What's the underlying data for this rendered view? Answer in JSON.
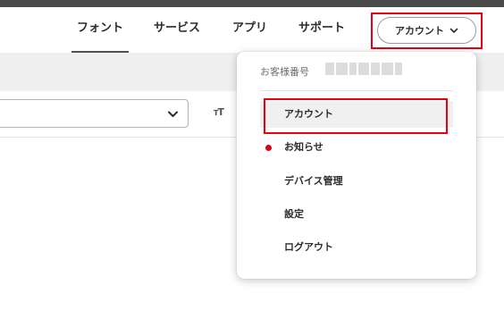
{
  "nav": {
    "links": [
      {
        "label": "フォント"
      },
      {
        "label": "サービス"
      },
      {
        "label": "アプリ"
      },
      {
        "label": "サポート"
      }
    ],
    "account_label": "アカウント"
  },
  "dropdown": {
    "customer_number_label": "お客様番号",
    "items": [
      {
        "label": "アカウント",
        "selected": true
      },
      {
        "label": "お知らせ",
        "notification": true
      },
      {
        "label": "デバイス管理"
      },
      {
        "label": "設定"
      },
      {
        "label": "ログアウト"
      }
    ]
  },
  "icons": {
    "text_size": "T",
    "text_size_small": "T",
    "select_chevron": "chevron-down-icon",
    "account_chevron": "chevron-down-icon"
  },
  "colors": {
    "highlight": "#e8000f",
    "notification_dot": "#d7001b",
    "topbar": "#4a4a4a"
  }
}
